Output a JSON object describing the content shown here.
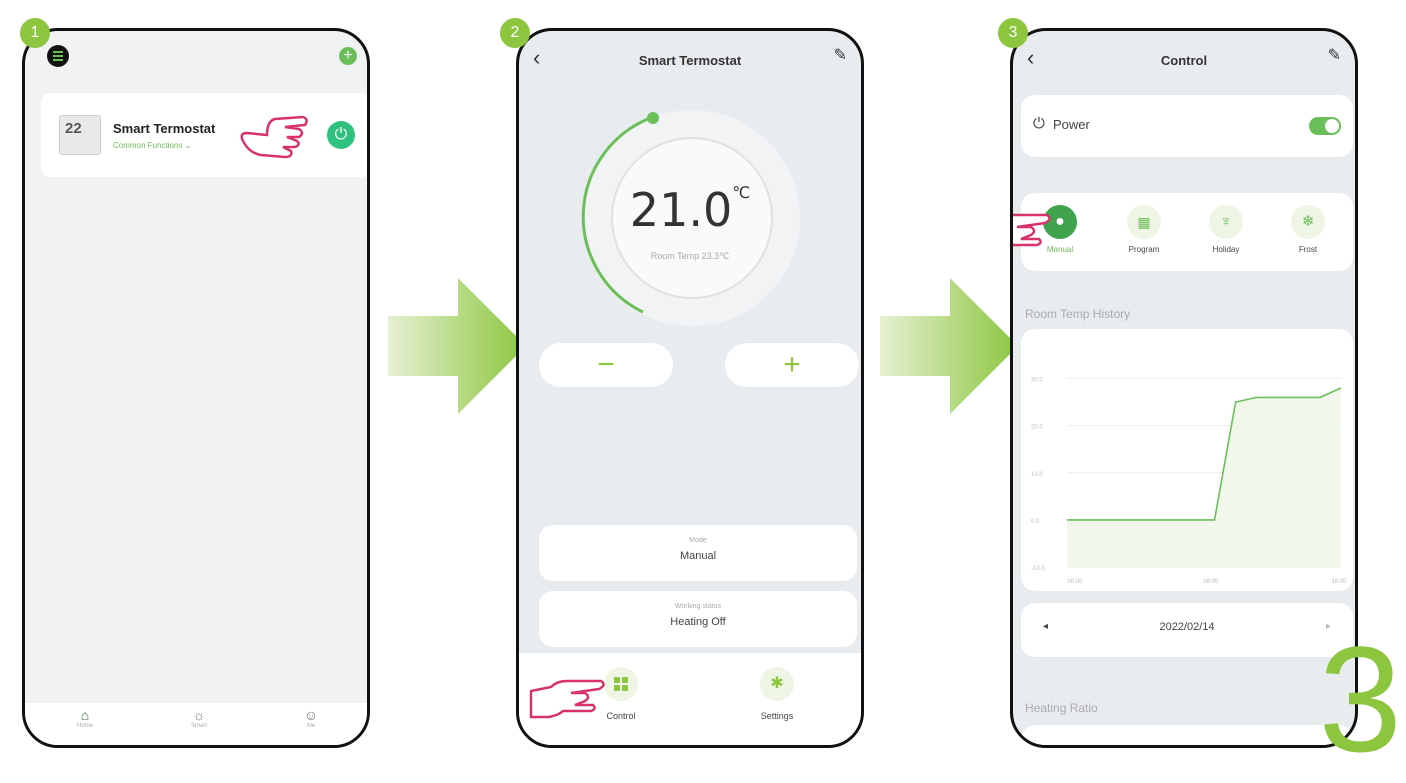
{
  "steps": [
    "1",
    "2",
    "3"
  ],
  "screen1": {
    "device_name": "Smart Termostat",
    "device_sub": "Common Functions ⌄",
    "device_temp_icon_text": "22",
    "nav": [
      {
        "label": "Home"
      },
      {
        "label": "Smart"
      },
      {
        "label": "Me"
      }
    ]
  },
  "screen2": {
    "title": "Smart Termostat",
    "set_temp": "21.0",
    "unit": "℃",
    "room_temp": "Room Temp 23.3℃",
    "minus": "−",
    "plus": "+",
    "mode_label": "Mode",
    "mode_value": "Manual",
    "status_label": "Working status",
    "status_value": "Heating Off",
    "control_label": "Control",
    "settings_label": "Settings"
  },
  "screen3": {
    "title": "Control",
    "power_label": "Power",
    "modes": [
      {
        "label": "Manual"
      },
      {
        "label": "Program"
      },
      {
        "label": "Holiday"
      },
      {
        "label": "Frost"
      }
    ],
    "history_title": "Room Temp History",
    "date": "2022/02/14",
    "heating_ratio": "Heating Ratio",
    "corner_number": "3"
  },
  "chart_data": {
    "type": "line",
    "y_ticks": [
      "30.0",
      "20.0",
      "10.0",
      "0.0",
      "-10.0"
    ],
    "x_ticks": [
      "00:00",
      "08:00",
      "16:00"
    ],
    "series": [
      {
        "values": [
          0,
          0,
          0,
          0,
          0,
          0,
          0,
          0,
          25,
          26,
          26,
          26,
          26,
          28
        ]
      }
    ],
    "ylim": [
      -10,
      35
    ],
    "grid": true
  },
  "colors": {
    "accent": "#6bbf59",
    "step": "#8cc63f",
    "hand": "#d6336c"
  }
}
